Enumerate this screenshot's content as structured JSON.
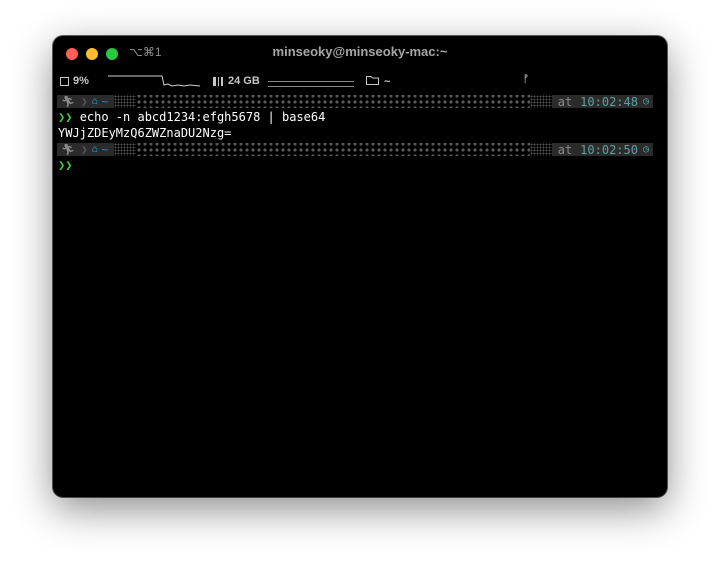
{
  "window": {
    "title": "minseoky@minseoky-mac:~",
    "shortcut": "⌥⌘1"
  },
  "statusbar": {
    "cpu": "9%",
    "memory": "24 GB",
    "folder": "~"
  },
  "prompts": [
    {
      "at": "at",
      "time": "10:02:48"
    },
    {
      "at": "at",
      "time": "10:02:50"
    }
  ],
  "terminal": {
    "prompt_symbol": "❯❯",
    "command": "echo -n abcd1234:efgh5678 | base64",
    "output": "YWJjZDEyMzQ6ZWZnaDU2Nzg="
  },
  "colors": {
    "background": "#000000",
    "prompt_green": "#3fcf4f",
    "time_teal": "#5f9ea0",
    "home_blue": "#1e90c8"
  },
  "icons": [
    "cpu-icon",
    "memory-icon",
    "folder-icon",
    "branch-icon",
    "running-man-icon",
    "home-icon",
    "clock-icon"
  ]
}
